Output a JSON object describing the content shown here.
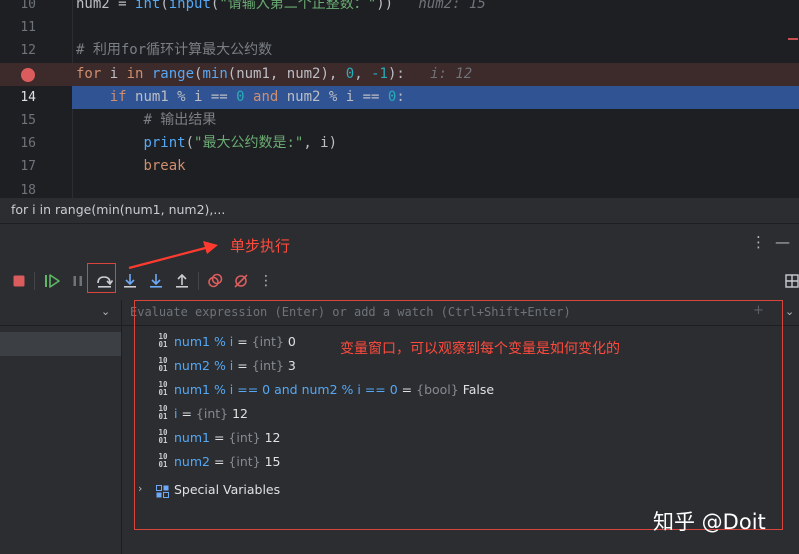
{
  "editor": {
    "lines": [
      {
        "num": "10",
        "tokens": [
          [
            "num2 = ",
            ""
          ],
          [
            "int",
            "fn"
          ],
          [
            "(",
            ""
          ],
          [
            "input",
            "fn"
          ],
          [
            "(",
            ""
          ],
          [
            "\"请输入第二个正整数：\"",
            "str"
          ],
          [
            "))",
            ""
          ],
          [
            "   num2: 15",
            "hint"
          ]
        ]
      },
      {
        "num": "11",
        "tokens": []
      },
      {
        "num": "12",
        "tokens": [
          [
            "# 利用for循环计算最大公约数",
            "cmt"
          ]
        ]
      },
      {
        "num": "",
        "breakpoint": true,
        "tokens": [
          [
            "for ",
            "kw"
          ],
          [
            "i ",
            ""
          ],
          [
            "in ",
            "kw"
          ],
          [
            "range",
            "fn"
          ],
          [
            "(",
            ""
          ],
          [
            "min",
            "fn"
          ],
          [
            "(num1, num2), ",
            ""
          ],
          [
            "0",
            "num"
          ],
          [
            ", ",
            ""
          ],
          [
            "-1",
            "num"
          ],
          [
            "):",
            ""
          ],
          [
            "   i: 12",
            "hint"
          ]
        ]
      },
      {
        "num": "14",
        "current": true,
        "tokens": [
          [
            "    ",
            ""
          ],
          [
            "if ",
            "kw"
          ],
          [
            "num1 % i == ",
            ""
          ],
          [
            "0 ",
            "num"
          ],
          [
            "and ",
            "kw"
          ],
          [
            "num2 % i == ",
            ""
          ],
          [
            "0",
            "num"
          ],
          [
            ":",
            ""
          ]
        ]
      },
      {
        "num": "15",
        "tokens": [
          [
            "        ",
            ""
          ],
          [
            "# 输出结果",
            "cmt"
          ]
        ]
      },
      {
        "num": "16",
        "tokens": [
          [
            "        ",
            ""
          ],
          [
            "print",
            "fn"
          ],
          [
            "(",
            ""
          ],
          [
            "\"最大公约数是:\"",
            "str"
          ],
          [
            ", i)",
            ""
          ]
        ]
      },
      {
        "num": "17",
        "tokens": [
          [
            "        ",
            ""
          ],
          [
            "break",
            "kw"
          ]
        ]
      },
      {
        "num": "18",
        "tokens": []
      }
    ]
  },
  "breadcrumb": "for i in range(min(num1, num2),...",
  "header": {
    "more_icon": "more-vertical-icon",
    "minimize_icon": "minimize-icon"
  },
  "toolbar": {
    "buttons": [
      "stop-icon",
      "resume-icon",
      "pause-icon",
      "step-over-icon",
      "step-into-icon",
      "step-into-my-code-icon",
      "step-out-icon",
      "view-breakpoints-icon",
      "mute-breakpoints-icon",
      "more-icon"
    ],
    "layout_icon": "layout-icon"
  },
  "evaluate": {
    "placeholder": "Evaluate expression (Enter) or add a watch (Ctrl+Shift+Enter)"
  },
  "variables": [
    {
      "name": "num1 % i",
      "type": "{int}",
      "value": "0"
    },
    {
      "name": "num2 % i",
      "type": "{int}",
      "value": "3"
    },
    {
      "name": "num1 % i == 0 and num2 % i == 0",
      "type": "{bool}",
      "value": "False"
    },
    {
      "name": "i",
      "type": "{int}",
      "value": "12"
    },
    {
      "name": "num1",
      "type": "{int}",
      "value": "12"
    },
    {
      "name": "num2",
      "type": "{int}",
      "value": "15"
    }
  ],
  "special_variables": "Special Variables",
  "annotations": {
    "step_label": "单步执行",
    "vars_label": "变量窗口，可以观察到每个变量是如何变化的",
    "color": "#d9443c"
  },
  "watermark": "知乎 @Doit"
}
